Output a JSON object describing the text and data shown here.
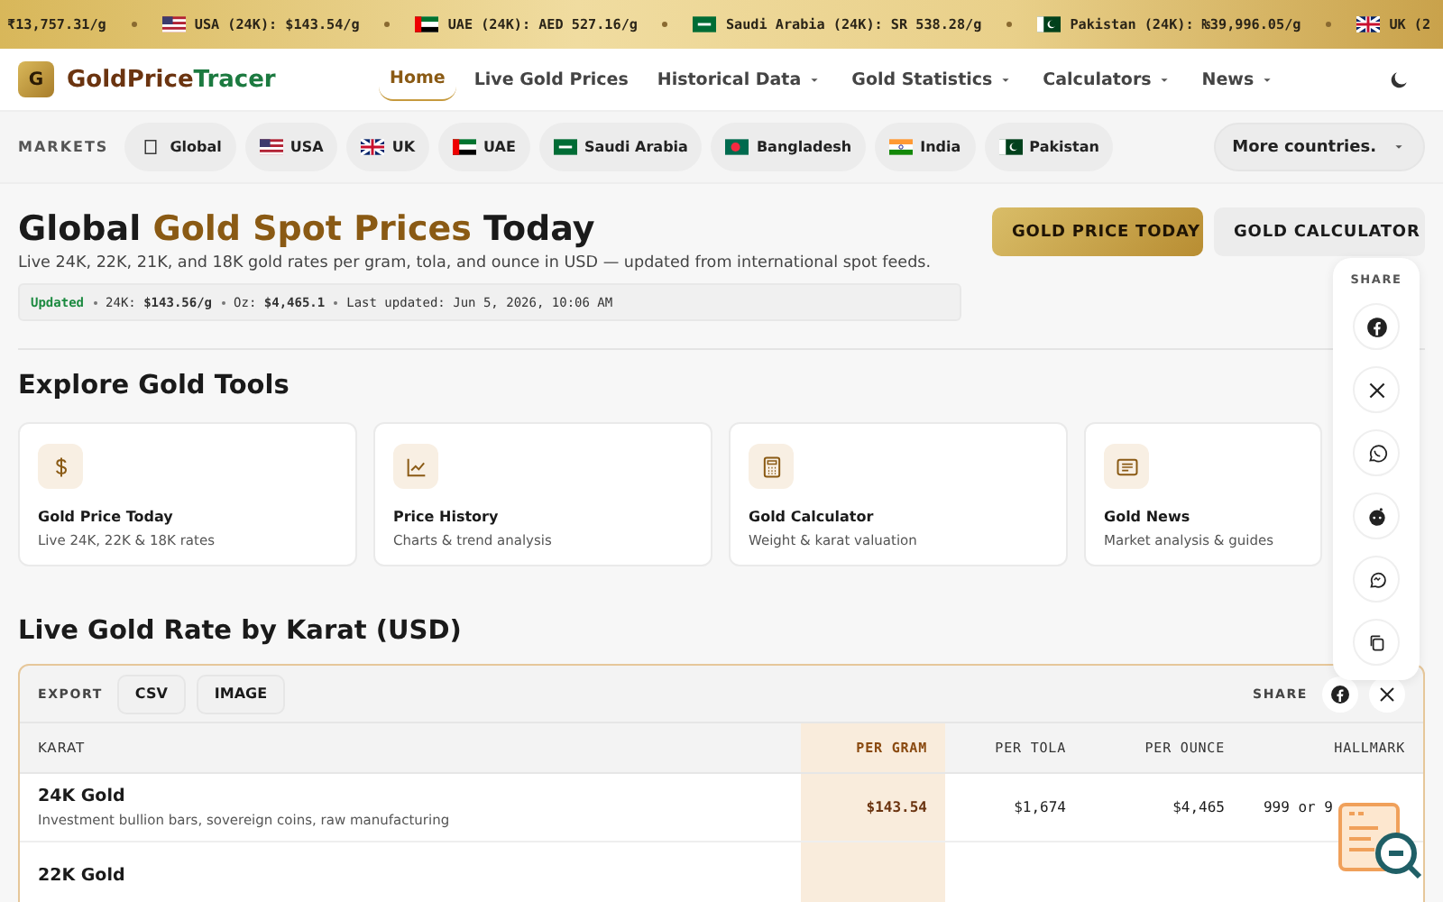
{
  "ticker": [
    {
      "text": "₹13,757.31/g"
    },
    {
      "kind": "us",
      "text": "USA (24K): $143.54/g"
    },
    {
      "kind": "ae",
      "text": "UAE (24K): AED 527.16/g"
    },
    {
      "kind": "sa",
      "text": "Saudi Arabia (24K): SR 538.28/g"
    },
    {
      "kind": "pk",
      "text": "Pakistan (24K): ₨39,996.05/g"
    },
    {
      "kind": "uk",
      "text": "UK (2"
    }
  ],
  "brand": {
    "logo": "G",
    "name_a": "GoldPrice",
    "name_b": "Tracer"
  },
  "nav": [
    {
      "label": "Home",
      "selected": true,
      "dropdown": false
    },
    {
      "label": "Live Gold Prices",
      "selected": false,
      "dropdown": false
    },
    {
      "label": "Historical Data",
      "selected": false,
      "dropdown": true
    },
    {
      "label": "Gold Statistics",
      "selected": false,
      "dropdown": true
    },
    {
      "label": "Calculators",
      "selected": false,
      "dropdown": true
    },
    {
      "label": "News",
      "selected": false,
      "dropdown": true
    }
  ],
  "markets": {
    "label": "MARKETS",
    "items": [
      {
        "kind": "globe",
        "label": "Global"
      },
      {
        "kind": "us",
        "label": "USA"
      },
      {
        "kind": "uk",
        "label": "UK"
      },
      {
        "kind": "ae",
        "label": "UAE"
      },
      {
        "kind": "sa",
        "label": "Saudi Arabia"
      },
      {
        "kind": "bd",
        "label": "Bangladesh"
      },
      {
        "kind": "in",
        "label": "India"
      },
      {
        "kind": "pk",
        "label": "Pakistan"
      }
    ],
    "more": "More countries."
  },
  "hero": {
    "title_a": "Global ",
    "title_b": "Gold Spot Prices",
    "title_c": " Today",
    "subtitle": "Live 24K, 22K, 21K, and 18K gold rates per gram, tola, and ounce in USD — updated from international spot feeds.",
    "status": "Updated",
    "facts": [
      "24K: **$143.56/g**",
      "Oz: **$4,465.1**",
      "Last updated: Jun 5, 2026, 10:06 AM"
    ],
    "buttons": [
      {
        "label": "GOLD PRICE TODAY",
        "kind": "primary"
      },
      {
        "label": "GOLD CALCULATOR",
        "kind": "secondary"
      }
    ]
  },
  "share_panel": {
    "label": "SHARE",
    "items": [
      {
        "kind": "facebook"
      },
      {
        "kind": "x"
      },
      {
        "kind": "whatsapp"
      },
      {
        "kind": "reddit"
      },
      {
        "kind": "chat"
      },
      {
        "kind": "copy"
      }
    ]
  },
  "tools": {
    "title": "Explore Gold Tools",
    "cards": [
      {
        "kind": "dollar",
        "title": "Gold Price Today",
        "text": "Live 24K, 22K & 18K rates"
      },
      {
        "kind": "chart",
        "title": "Price History",
        "text": "Charts & trend analysis"
      },
      {
        "kind": "calculator",
        "title": "Gold Calculator",
        "text": "Weight & karat valuation"
      },
      {
        "kind": "news",
        "title": "Gold News",
        "text": "Market analysis & guides"
      }
    ]
  },
  "rates": {
    "title": "Live Gold Rate by Karat (USD)",
    "export_label": "EXPORT",
    "export_buttons": [
      "CSV",
      "IMAGE"
    ],
    "share_label": "SHARE",
    "share": [
      {
        "kind": "facebook"
      },
      {
        "kind": "x"
      }
    ],
    "columns": [
      "KARAT",
      "PER GRAM",
      "PER TOLA",
      "PER OUNCE",
      "HALLMARK"
    ],
    "rows": [
      {
        "karat": "24K Gold",
        "use": "Investment bullion bars, sovereign coins, raw manufacturing",
        "per_gram": "$143.54",
        "per_tola": "$1,674",
        "per_ounce": "$4,465",
        "hallmark": "999 or 9"
      },
      {
        "karat": "22K Gold"
      }
    ]
  }
}
